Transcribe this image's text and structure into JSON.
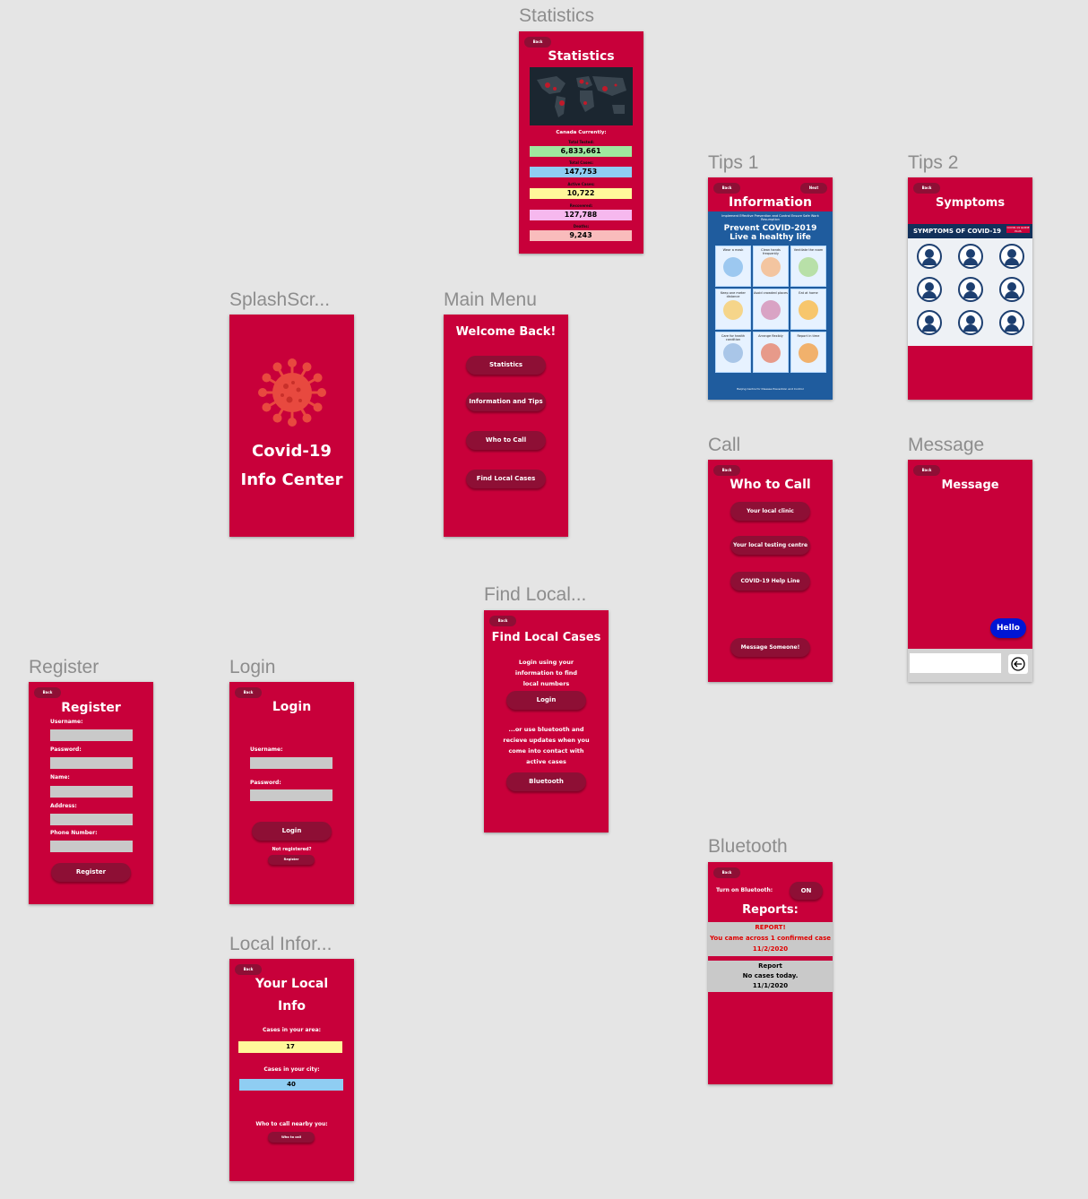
{
  "canvas_labels": {
    "statistics": "Statistics",
    "tips1": "Tips 1",
    "tips2": "Tips 2",
    "splash": "SplashScr...",
    "main_menu": "Main Menu",
    "call": "Call",
    "message": "Message",
    "find_local": "Find Local...",
    "register": "Register",
    "login": "Login",
    "bluetooth": "Bluetooth",
    "local_info": "Local Infor..."
  },
  "common": {
    "back": "Back",
    "next": "Next"
  },
  "statistics": {
    "title": "Statistics",
    "canada_label": "Canada Currently:",
    "rows": [
      {
        "label": "Total Tested:",
        "value": "6,833,661",
        "color": "#9fe89f"
      },
      {
        "label": "Total Cases:",
        "value": "147,753",
        "color": "#8fcdf2"
      },
      {
        "label": "Active Cases:",
        "value": "10,722",
        "color": "#fff89a"
      },
      {
        "label": "Recovered:",
        "value": "127,788",
        "color": "#f6b8ee"
      },
      {
        "label": "Deaths:",
        "value": "9,243",
        "color": "#f9bcbc"
      }
    ]
  },
  "tips1": {
    "title": "Information",
    "poster_small": "Implement Effective Prevention and Control  Ensure Safe Work Resumption",
    "poster_title1": "Prevent COVID-2019",
    "poster_title2": "Live a healthy life",
    "cells": [
      "Wear a mask",
      "Clean hands frequently",
      "Ventilate the room",
      "Keep one meter distance",
      "Avoid crowded places",
      "Eat at home",
      "Care for health condition",
      "Arrange flexibly",
      "Report in time"
    ],
    "footer": "Beijing Centre for Disease Prevention and Control"
  },
  "tips2": {
    "title": "Symptoms",
    "banner": "SYMPTOMS OF COVID-19",
    "banner_tag": "COVID-19 GUIDE PLUS"
  },
  "splash": {
    "line1": "Covid-19",
    "line2": "Info Center"
  },
  "main_menu": {
    "title": "Welcome Back!",
    "buttons": [
      "Statistics",
      "Information and Tips",
      "Who to Call",
      "Find Local Cases"
    ]
  },
  "call": {
    "title": "Who to Call",
    "buttons": [
      "Your local clinic",
      "Your local testing centre",
      "COVID-19 Help Line",
      "Message Someone!"
    ]
  },
  "message": {
    "title": "Message",
    "bubble": "Hello",
    "input_placeholder": "",
    "send_icon": "arrow-left-icon"
  },
  "find_local": {
    "title": "Find Local Cases",
    "text1": "Login using your information to find local numbers",
    "login_btn": "Login",
    "text2": "...or use bluetooth and recieve updates when you come into contact with active cases",
    "bluetooth_btn": "Bluetooth"
  },
  "register": {
    "title": "Register",
    "fields": [
      "Username:",
      "Password:",
      "Name:",
      "Address:",
      "Phone Number:"
    ],
    "button": "Register"
  },
  "login": {
    "title": "Login",
    "username": "Username:",
    "password": "Password:",
    "button": "Login",
    "not_registered": "Not registered?",
    "register_btn": "Register"
  },
  "bluetooth": {
    "turn_on": "Turn on Bluetooth:",
    "toggle": "ON",
    "reports_title": "Reports:",
    "report1": {
      "title": "REPORT!",
      "text": "You came across 1 confirmed case",
      "date": "11/2/2020",
      "color": "#e00000"
    },
    "report2": {
      "title": "Report",
      "text": "No cases today.",
      "date": "11/1/2020"
    }
  },
  "local_info": {
    "title1": "Your Local",
    "title2": "Info",
    "area_label": "Cases in your area:",
    "area_value": "17",
    "city_label": "Cases in your city:",
    "city_value": "40",
    "call_label": "Who to call nearby you:",
    "call_btn": "Who to call"
  },
  "colors": {
    "frame": "#c8003a",
    "button": "#8e0f35",
    "canvas": "#e5e5e5"
  }
}
